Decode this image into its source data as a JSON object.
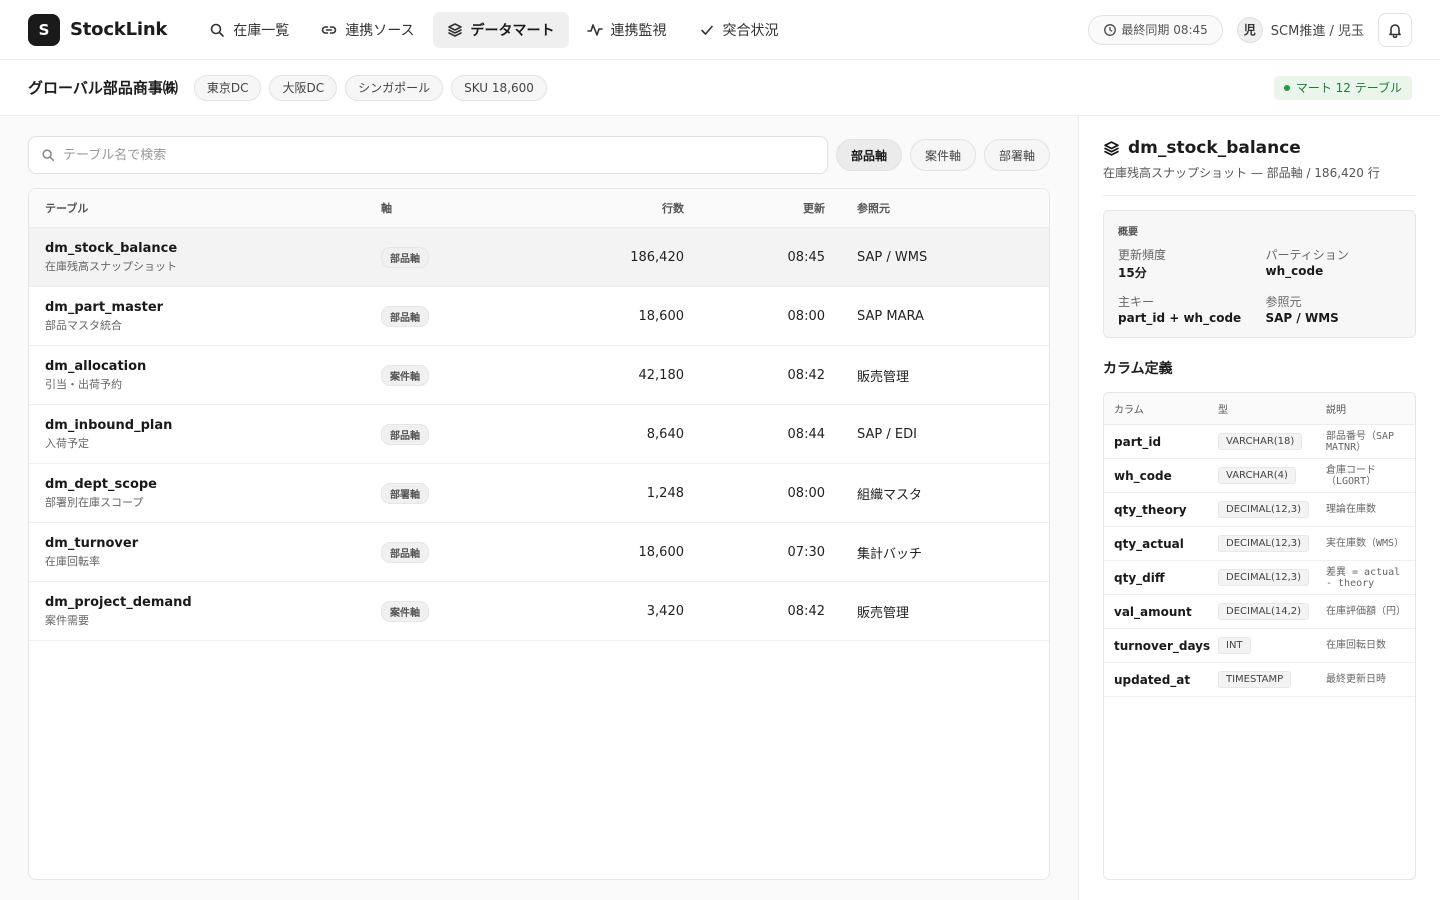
{
  "app": {
    "logo_letter": "S",
    "name": "StockLink"
  },
  "nav": [
    {
      "label": "在庫一覧",
      "icon": "search-icon",
      "active": false
    },
    {
      "label": "連携ソース",
      "icon": "link-icon",
      "active": false
    },
    {
      "label": "データマート",
      "icon": "layers-icon",
      "active": true
    },
    {
      "label": "連携監視",
      "icon": "activity-icon",
      "active": false
    },
    {
      "label": "突合状況",
      "icon": "check-icon",
      "active": false
    }
  ],
  "header": {
    "sync_label": "最終同期 08:45",
    "avatar_initial": "児",
    "user_label": "SCM推進 / 児玉"
  },
  "subheader": {
    "company": "グローバル部品商事㈱",
    "chips": [
      "東京DC",
      "大阪DC",
      "シンガポール",
      "SKU 18,600"
    ],
    "mart_badge": "マート 12 テーブル"
  },
  "search": {
    "placeholder": "テーブル名で検索",
    "value": ""
  },
  "axis_filters": [
    {
      "label": "部品軸",
      "active": true
    },
    {
      "label": "案件軸",
      "active": false
    },
    {
      "label": "部署軸",
      "active": false
    }
  ],
  "table": {
    "headers": {
      "name": "テーブル",
      "axis": "軸",
      "rows": "行数",
      "updated": "更新",
      "ref": "参照元"
    },
    "rows": [
      {
        "name": "dm_stock_balance",
        "desc": "在庫残高スナップショット",
        "axis": "部品軸",
        "rows": "186,420",
        "updated": "08:45",
        "ref": "SAP / WMS",
        "selected": true
      },
      {
        "name": "dm_part_master",
        "desc": "部品マスタ統合",
        "axis": "部品軸",
        "rows": "18,600",
        "updated": "08:00",
        "ref": "SAP MARA",
        "selected": false
      },
      {
        "name": "dm_allocation",
        "desc": "引当・出荷予約",
        "axis": "案件軸",
        "rows": "42,180",
        "updated": "08:42",
        "ref": "販売管理",
        "selected": false
      },
      {
        "name": "dm_inbound_plan",
        "desc": "入荷予定",
        "axis": "部品軸",
        "rows": "8,640",
        "updated": "08:44",
        "ref": "SAP / EDI",
        "selected": false
      },
      {
        "name": "dm_dept_scope",
        "desc": "部署別在庫スコープ",
        "axis": "部署軸",
        "rows": "1,248",
        "updated": "08:00",
        "ref": "組織マスタ",
        "selected": false
      },
      {
        "name": "dm_turnover",
        "desc": "在庫回転率",
        "axis": "部品軸",
        "rows": "18,600",
        "updated": "07:30",
        "ref": "集計バッチ",
        "selected": false
      },
      {
        "name": "dm_project_demand",
        "desc": "案件需要",
        "axis": "案件軸",
        "rows": "3,420",
        "updated": "08:42",
        "ref": "販売管理",
        "selected": false
      }
    ]
  },
  "detail": {
    "title": "dm_stock_balance",
    "subtitle": "在庫残高スナップショット — 部品軸 / 186,420 行",
    "overview_label": "概要",
    "overview": [
      {
        "label": "更新頻度",
        "value": "15分"
      },
      {
        "label": "パーティション",
        "value": "wh_code"
      },
      {
        "label": "主キー",
        "value": "part_id + wh_code"
      },
      {
        "label": "参照元",
        "value": "SAP / WMS"
      }
    ],
    "columns_title": "カラム定義",
    "columns_headers": {
      "name": "カラム",
      "type": "型",
      "desc": "説明"
    },
    "columns": [
      {
        "name": "part_id",
        "type": "VARCHAR(18)",
        "desc": "部品番号（SAP MATNR）"
      },
      {
        "name": "wh_code",
        "type": "VARCHAR(4)",
        "desc": "倉庫コード（LGORT）"
      },
      {
        "name": "qty_theory",
        "type": "DECIMAL(12,3)",
        "desc": "理論在庫数"
      },
      {
        "name": "qty_actual",
        "type": "DECIMAL(12,3)",
        "desc": "実在庫数（WMS）"
      },
      {
        "name": "qty_diff",
        "type": "DECIMAL(12,3)",
        "desc": "差異 = actual - theory"
      },
      {
        "name": "val_amount",
        "type": "DECIMAL(14,2)",
        "desc": "在庫評価額（円）"
      },
      {
        "name": "turnover_days",
        "type": "INT",
        "desc": "在庫回転日数"
      },
      {
        "name": "updated_at",
        "type": "TIMESTAMP",
        "desc": "最終更新日時"
      }
    ]
  }
}
